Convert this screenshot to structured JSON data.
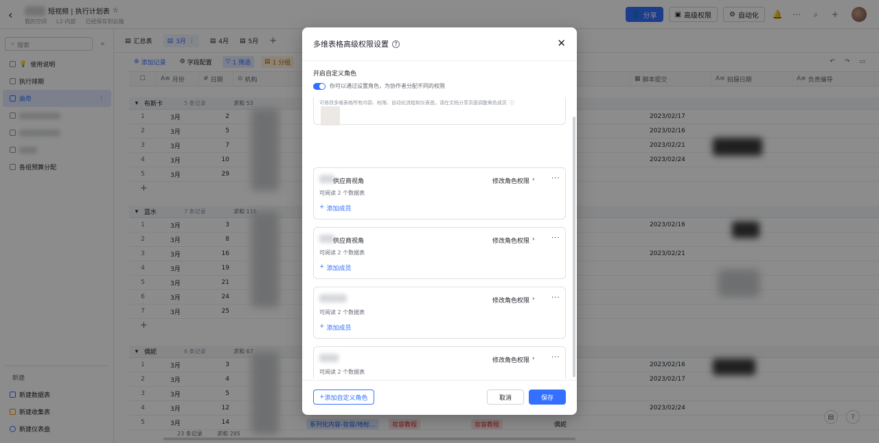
{
  "topbar": {
    "doc_title": "短视频 | 执行计划表",
    "space": "我的空间",
    "level": "L2-内部",
    "saved": "已经保存到云端",
    "share": "分享",
    "advanced_perm": "高级权限",
    "automation": "自动化"
  },
  "sidebar": {
    "search_placeholder": "搜索",
    "items": [
      {
        "label": "使用说明"
      },
      {
        "label": "执行排期"
      },
      {
        "label": "曲奇"
      },
      {
        "label": "各组预算分配"
      }
    ],
    "new_title": "新建",
    "new_items": [
      {
        "label": "新建数据表"
      },
      {
        "label": "新建收集表"
      },
      {
        "label": "新建仪表盘"
      }
    ]
  },
  "tabs": [
    {
      "label": "汇总表"
    },
    {
      "label": "3月"
    },
    {
      "label": "4月"
    },
    {
      "label": "5月"
    }
  ],
  "toolbar": {
    "add_record": "添加记录",
    "field_config": "字段配置",
    "filter": "1 筛选",
    "group": "1 分组"
  },
  "grid": {
    "columns": {
      "month": "月份",
      "day": "日期",
      "org": "机构",
      "script": "脚本提交",
      "shoot": "拍摄日期",
      "owner": "负责编导"
    },
    "groups": [
      {
        "name": "布斯卡",
        "count": "5 条记录",
        "sum": "求和 53",
        "rows": [
          {
            "idx": "1",
            "month": "3月",
            "day": "2",
            "date": "2023/02/17"
          },
          {
            "idx": "2",
            "month": "3月",
            "day": "5",
            "date": "2023/02/16"
          },
          {
            "idx": "3",
            "month": "3月",
            "day": "7",
            "date": "2023/02/21"
          },
          {
            "idx": "4",
            "month": "3月",
            "day": "10",
            "date": "2023/02/24"
          },
          {
            "idx": "5",
            "month": "3月",
            "day": "29",
            "date": ""
          }
        ]
      },
      {
        "name": "蓝水",
        "count": "7 条记录",
        "sum": "求和 116",
        "rows": [
          {
            "idx": "1",
            "month": "3月",
            "day": "3",
            "date": "2023/02/16"
          },
          {
            "idx": "2",
            "month": "3月",
            "day": "8",
            "date": ""
          },
          {
            "idx": "3",
            "month": "3月",
            "day": "16",
            "date": "2023/02/21"
          },
          {
            "idx": "4",
            "month": "3月",
            "day": "19",
            "date": ""
          },
          {
            "idx": "5",
            "month": "3月",
            "day": "21",
            "date": ""
          },
          {
            "idx": "6",
            "month": "3月",
            "day": "24",
            "date": ""
          },
          {
            "idx": "7",
            "month": "3月",
            "day": "25",
            "date": ""
          }
        ]
      },
      {
        "name": "偶妮",
        "count": "6 条记录",
        "sum": "求和 67",
        "rows": [
          {
            "idx": "1",
            "month": "3月",
            "day": "3",
            "date": "2023/02/16"
          },
          {
            "idx": "2",
            "month": "3月",
            "day": "4",
            "date": "2023/02/17"
          },
          {
            "idx": "3",
            "month": "3月",
            "day": "5",
            "date": ""
          },
          {
            "idx": "4",
            "month": "3月",
            "day": "12",
            "date": "2023/02/24"
          },
          {
            "idx": "5",
            "month": "3月",
            "day": "14",
            "date": ""
          }
        ]
      }
    ],
    "last_row_tags": [
      "系列化内容-妆容/地标...",
      "妆容教程",
      "妆容教程",
      "偶妮"
    ],
    "footer_count": "23 条记录",
    "footer_sum": "求和 295"
  },
  "modal": {
    "title": "多维表格高级权限设置",
    "toggle_label": "开启自定义角色",
    "toggle_desc": "你可以通过设置角色，为协作者分配不同的权限",
    "top_note": "可修改多维表格所有内容、权限、自动化流程和仪表盘。请在文档分享页面调整角色成员",
    "edit_label": "修改角色权限",
    "readable": "可阅读 2 个数据表",
    "add_member": "添加成员",
    "roles": [
      {
        "name": "供应商视角"
      },
      {
        "name": "供应商视角"
      },
      {
        "name": ""
      },
      {
        "name": ""
      }
    ],
    "add_role": "添加自定义角色",
    "cancel": "取消",
    "save": "保存"
  }
}
